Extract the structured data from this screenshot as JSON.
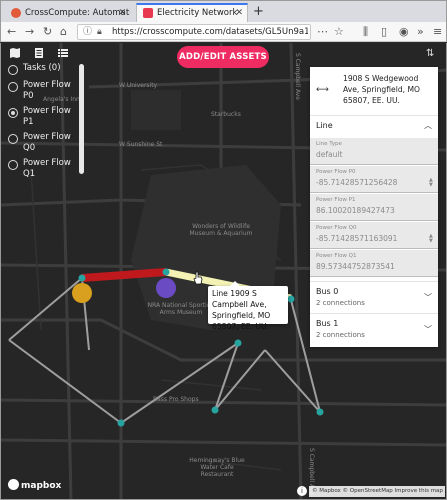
{
  "browser": {
    "tabs": [
      {
        "title": "CrossCompute: Automati"
      },
      {
        "title": "Electricity Network"
      }
    ],
    "url": "https://crosscompute.com/datasets/GL5Un9a1P..."
  },
  "map": {
    "street_labels": [
      "W University",
      "Starbucks",
      "W Sunshine St",
      "Wonders of Wildlife Museum & Aquarium",
      "NRA National Sporting Arms Museum",
      "Bass Pro Shops",
      "Hemingway's Blue Water Cafe Restaurant",
      "Angela's Inn",
      "S Campbell Ave",
      "S Campbell Ave"
    ],
    "layers": [
      {
        "label": "Tasks (0)",
        "selected": false
      },
      {
        "label": "Power Flow P0",
        "selected": false
      },
      {
        "label": "Power Flow P1",
        "selected": true
      },
      {
        "label": "Power Flow Q0",
        "selected": false
      },
      {
        "label": "Power Flow Q1",
        "selected": false
      }
    ],
    "add_button": "ADD/EDIT ASSETS",
    "tooltip": "Line 1909 S Campbell Ave, Springfield, MO 65807, EE. UU.",
    "logo": "mapbox",
    "attribution": "© Mapbox © OpenStreetMap Improve this map",
    "colors": {
      "accent": "#ee2c62",
      "line_red": "#c0191d",
      "line_yellow": "#f3f2b4",
      "node": "#27a3a0",
      "bus_yellow": "#d9a01f",
      "bus_purple": "#6a4bc4"
    }
  },
  "panel": {
    "address": "1908 S Wedgewood Ave, Springfield, MO 65807, EE. UU.",
    "section_title": "Line",
    "fields": [
      {
        "label": "Line Type",
        "value": "default"
      },
      {
        "label": "Power Flow P0",
        "value": "-85.71428571256428"
      },
      {
        "label": "Power Flow P1",
        "value": "86.10020189427473"
      },
      {
        "label": "Power Flow Q0",
        "value": "-85.71428571163091"
      },
      {
        "label": "Power Flow Q1",
        "value": "89.57344752873541"
      }
    ],
    "buses": [
      {
        "title": "Bus 0",
        "subtitle": "2 connections"
      },
      {
        "title": "Bus 1",
        "subtitle": "2 connections"
      }
    ]
  }
}
